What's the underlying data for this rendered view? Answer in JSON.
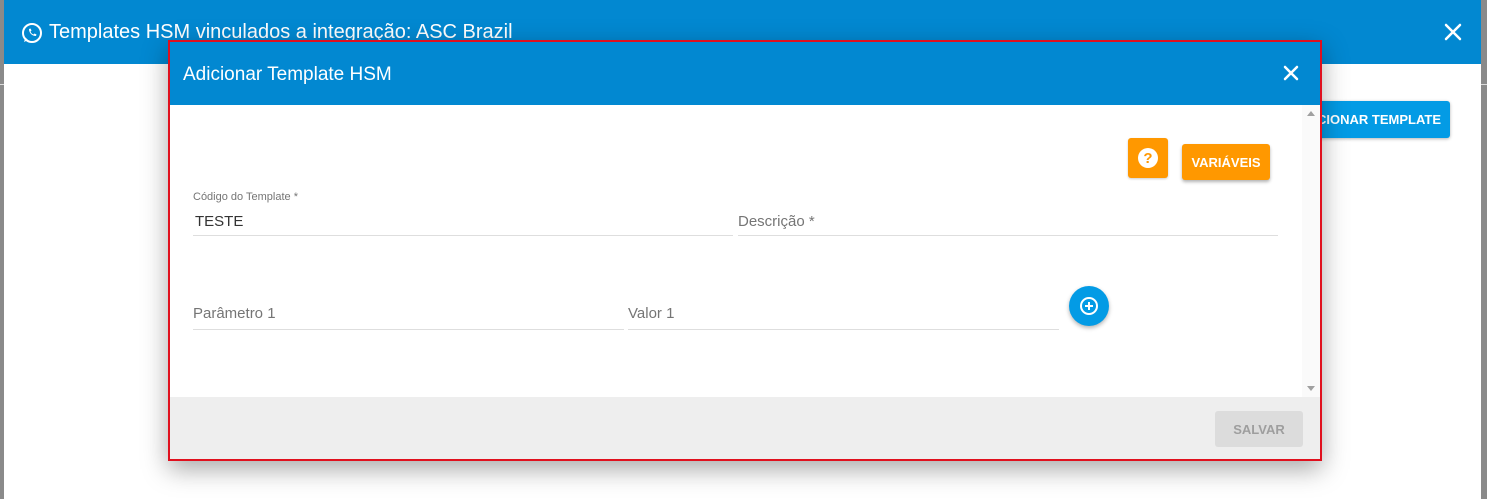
{
  "outer_dialog": {
    "title": "Templates HSM vinculados a integração: ASC Brazil",
    "add_template_label": "ADICIONAR TEMPLATE",
    "close_icon": "close-icon",
    "title_icon": "whatsapp-icon"
  },
  "modal": {
    "title": "Adicionar Template HSM",
    "close_icon": "close-icon",
    "help_icon": "question-icon",
    "help_symbol": "?",
    "variables_label": "VARIÁVEIS",
    "template_code": {
      "label": "Código do Template *",
      "value": "TESTE"
    },
    "description": {
      "placeholder": "Descrição *",
      "value": ""
    },
    "parameter_1": {
      "placeholder": "Parâmetro 1",
      "value": ""
    },
    "value_1": {
      "placeholder": "Valor 1",
      "value": ""
    },
    "add_param_icon": "plus-circle-icon",
    "save_label": "SALVAR"
  },
  "colors": {
    "header_blue": "#0288d1",
    "accent_blue": "#039be5",
    "orange": "#ff9800",
    "highlight_border": "#e0101e"
  }
}
